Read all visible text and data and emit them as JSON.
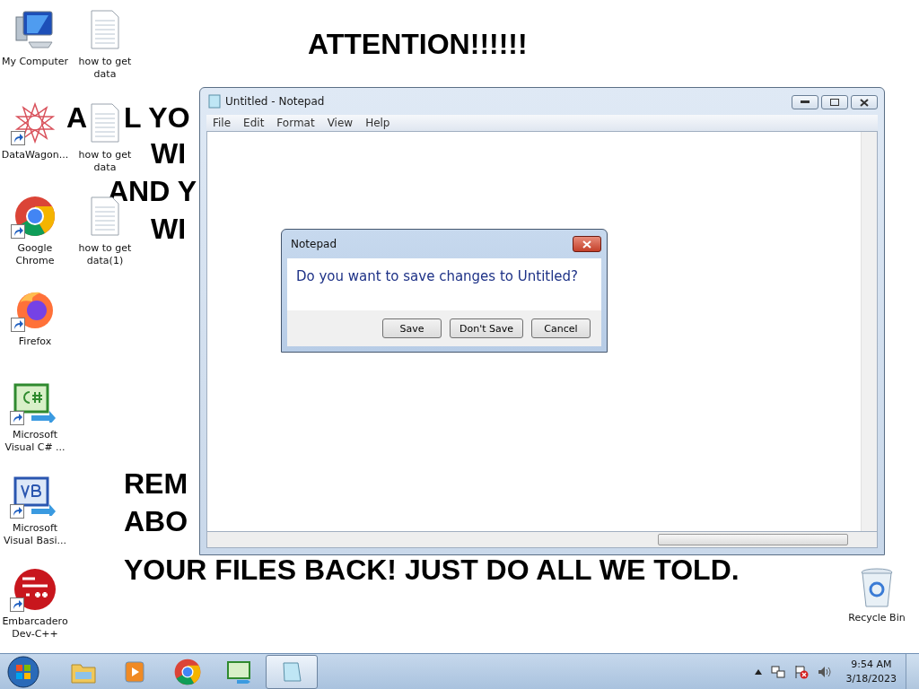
{
  "wallpaper": {
    "lines": [
      "ATTENTION!!!!!!",
      "A",
      "L YO",
      "WI",
      "AND Y",
      "WI",
      "REM",
      "ABO",
      "YOUR FILES BACK! JUST DO ALL WE TOLD."
    ]
  },
  "desktop_icons": [
    {
      "label": "My Computer",
      "kind": "computer",
      "shortcut": false
    },
    {
      "label": "DataWagon...",
      "kind": "star",
      "shortcut": true
    },
    {
      "label": "Google Chrome",
      "kind": "chrome",
      "shortcut": true
    },
    {
      "label": "Firefox",
      "kind": "firefox",
      "shortcut": true
    },
    {
      "label": "Microsoft Visual C# ...",
      "kind": "csharp",
      "shortcut": true
    },
    {
      "label": "Microsoft Visual Basi...",
      "kind": "vb",
      "shortcut": true
    },
    {
      "label": "Embarcadero Dev-C++",
      "kind": "dev",
      "shortcut": true
    },
    {
      "label": "how to get data",
      "kind": "text",
      "shortcut": false
    },
    {
      "label": "how to get data",
      "kind": "text",
      "shortcut": false
    },
    {
      "label": "how to get data(1)",
      "kind": "text",
      "shortcut": false
    }
  ],
  "recycle_bin": {
    "label": "Recycle Bin"
  },
  "notepad": {
    "title": "Untitled - Notepad",
    "menu": [
      "File",
      "Edit",
      "Format",
      "View",
      "Help"
    ]
  },
  "dialog": {
    "title": "Notepad",
    "message": "Do you want to save changes to Untitled?",
    "buttons": [
      "Save",
      "Don't Save",
      "Cancel"
    ]
  },
  "taskbar": {
    "items": [
      {
        "kind": "explorer",
        "active": false
      },
      {
        "kind": "media",
        "active": false
      },
      {
        "kind": "chrome",
        "active": false
      },
      {
        "kind": "csharp",
        "active": false
      },
      {
        "kind": "notepad",
        "active": true
      }
    ],
    "clock": {
      "time": "9:54 AM",
      "date": "3/18/2023"
    }
  }
}
